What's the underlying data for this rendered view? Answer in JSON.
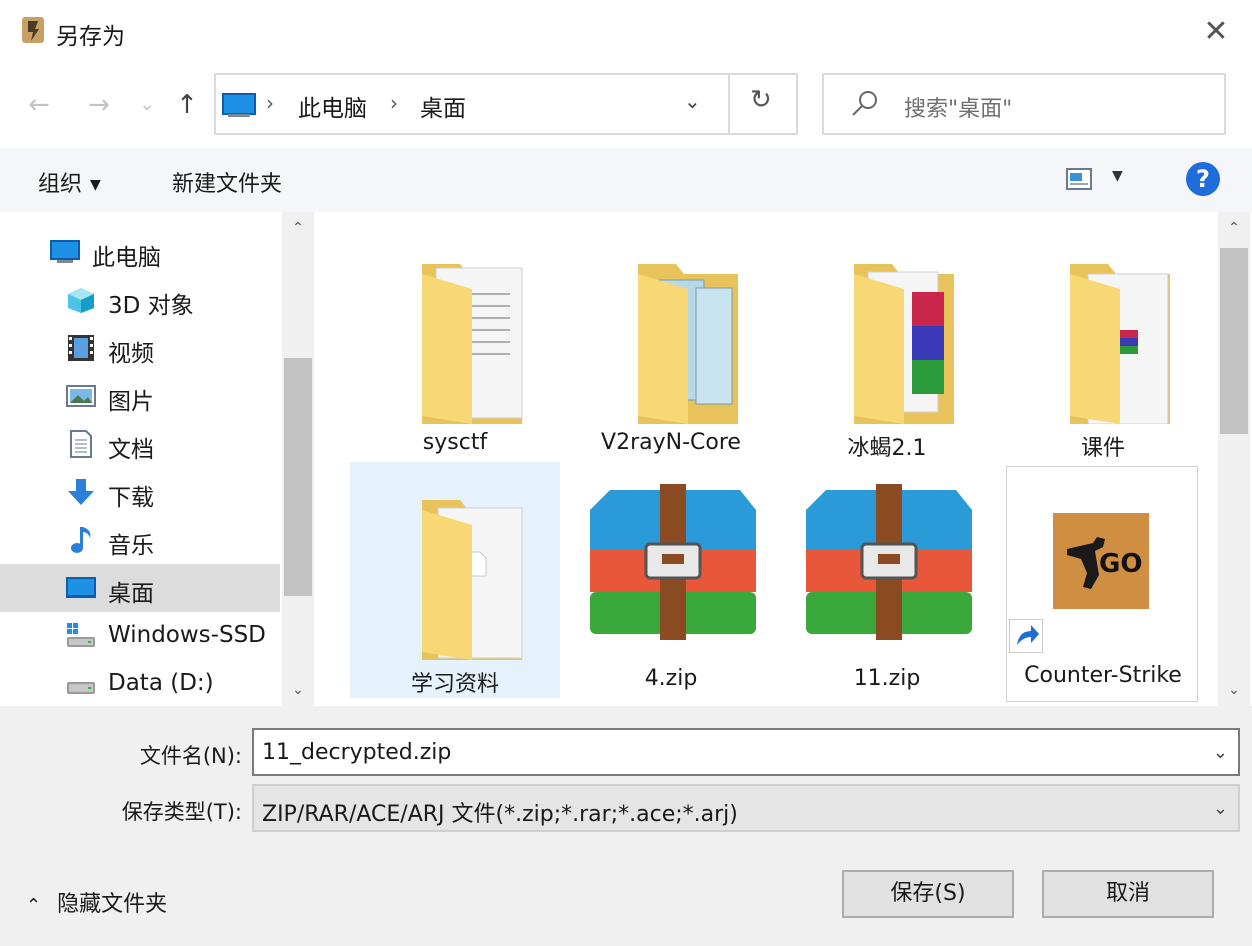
{
  "dialog": {
    "title": "另存为",
    "close_glyph": "✕"
  },
  "nav": {
    "back_glyph": "←",
    "forward_glyph": "→",
    "recent_glyph": "⌄",
    "up_glyph": "↑",
    "breadcrumb": [
      "此电脑",
      "桌面"
    ],
    "crumb_sep": "›",
    "dropdown_glyph": "⌄",
    "refresh_glyph": "↻",
    "search_placeholder": "搜索\"桌面\""
  },
  "toolbar": {
    "organize_label": "组织",
    "new_folder_label": "新建文件夹",
    "caret": "▼",
    "help_glyph": "?"
  },
  "navpane": {
    "items": [
      {
        "label": "此电脑",
        "icon": "computer-icon"
      },
      {
        "label": "3D 对象",
        "icon": "cube-3d-icon"
      },
      {
        "label": "视频",
        "icon": "video-icon"
      },
      {
        "label": "图片",
        "icon": "picture-icon"
      },
      {
        "label": "文档",
        "icon": "document-icon"
      },
      {
        "label": "下载",
        "icon": "download-icon"
      },
      {
        "label": "音乐",
        "icon": "music-icon"
      },
      {
        "label": "桌面",
        "icon": "desktop-icon",
        "selected": true
      },
      {
        "label": "Windows-SSD",
        "icon": "drive-windows-icon"
      },
      {
        "label": "Data (D:)",
        "icon": "drive-icon"
      }
    ],
    "scroll_up": "⌃",
    "scroll_down": "⌄"
  },
  "files": [
    {
      "name": "sysctf",
      "type": "folder"
    },
    {
      "name": "V2rayN-Core",
      "type": "folder"
    },
    {
      "name": "冰蝎2.1",
      "type": "folder"
    },
    {
      "name": "课件",
      "type": "folder"
    },
    {
      "name": "学习资料",
      "type": "folder",
      "selected": true
    },
    {
      "name": "4.zip",
      "type": "zip"
    },
    {
      "name": "11.zip",
      "type": "zip"
    },
    {
      "name": "Counter-Strike",
      "type": "shortcut",
      "badge_text": "GO"
    }
  ],
  "bottom": {
    "filename_label": "文件名(N):",
    "filename_value": "11_decrypted.zip",
    "filetype_label": "保存类型(T):",
    "filetype_value": "ZIP/RAR/ACE/ARJ 文件(*.zip;*.rar;*.ace;*.arj)",
    "chevron": "⌄",
    "hide_folders_label": "隐藏文件夹",
    "hide_chevron": "⌃",
    "save_label": "保存(S)",
    "cancel_label": "取消"
  },
  "colors": {
    "accent": "#1d6ddb",
    "folder": "#f8d775",
    "selected_tile": "#e5f1fb",
    "selected_nav": "#dcdcdc"
  }
}
